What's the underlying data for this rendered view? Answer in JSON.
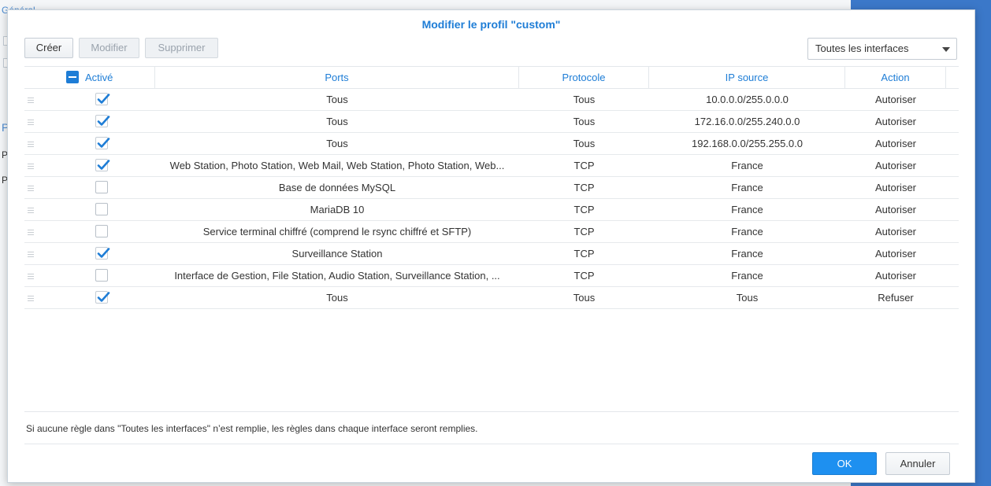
{
  "background": {
    "items": [
      "Général",
      "P",
      "P",
      "P"
    ]
  },
  "dialog": {
    "title": "Modifier le profil \"custom\"",
    "toolbar": {
      "create": "Créer",
      "edit": "Modifier",
      "delete": "Supprimer"
    },
    "interface_select": "Toutes les interfaces",
    "columns": {
      "active": "Activé",
      "ports": "Ports",
      "protocol": "Protocole",
      "source_ip": "IP source",
      "action": "Action"
    },
    "rows": [
      {
        "active": true,
        "ports": "Tous",
        "protocol": "Tous",
        "source_ip": "10.0.0.0/255.0.0.0",
        "action": "Autoriser"
      },
      {
        "active": true,
        "ports": "Tous",
        "protocol": "Tous",
        "source_ip": "172.16.0.0/255.240.0.0",
        "action": "Autoriser"
      },
      {
        "active": true,
        "ports": "Tous",
        "protocol": "Tous",
        "source_ip": "192.168.0.0/255.255.0.0",
        "action": "Autoriser"
      },
      {
        "active": true,
        "ports": "Web Station, Photo Station, Web Mail, Web Station, Photo Station, Web...",
        "protocol": "TCP",
        "source_ip": "France",
        "action": "Autoriser"
      },
      {
        "active": false,
        "ports": "Base de données MySQL",
        "protocol": "TCP",
        "source_ip": "France",
        "action": "Autoriser"
      },
      {
        "active": false,
        "ports": "MariaDB 10",
        "protocol": "TCP",
        "source_ip": "France",
        "action": "Autoriser"
      },
      {
        "active": false,
        "ports": "Service terminal chiffré (comprend le rsync chiffré et SFTP)",
        "protocol": "TCP",
        "source_ip": "France",
        "action": "Autoriser"
      },
      {
        "active": true,
        "ports": "Surveillance Station",
        "protocol": "TCP",
        "source_ip": "France",
        "action": "Autoriser"
      },
      {
        "active": false,
        "ports": "Interface de Gestion, File Station, Audio Station, Surveillance Station, ...",
        "protocol": "TCP",
        "source_ip": "France",
        "action": "Autoriser"
      },
      {
        "active": true,
        "ports": "Tous",
        "protocol": "Tous",
        "source_ip": "Tous",
        "action": "Refuser"
      }
    ],
    "note": "Si aucune règle dans \"Toutes les interfaces\" n’est remplie, les règles dans chaque interface seront remplies.",
    "ok": "OK",
    "cancel": "Annuler"
  },
  "colors": {
    "accent": "#1e7dd6",
    "primary_button": "#1e90f0"
  }
}
